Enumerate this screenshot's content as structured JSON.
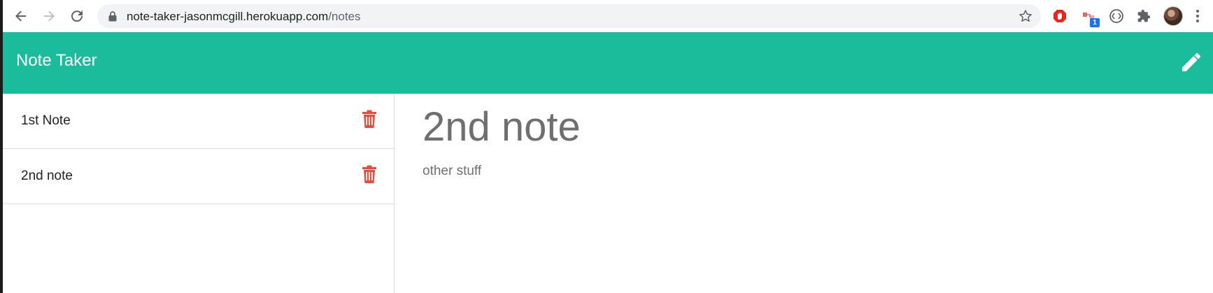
{
  "browser": {
    "url_host": "note-taker-jasonmcgill.herokuapp.com",
    "url_path": "/notes",
    "extension_badge_count": "1",
    "icons": [
      "back-icon",
      "forward-icon",
      "reload-icon",
      "lock-icon",
      "star-icon",
      "adblock-icon",
      "extension-badge-icon",
      "extension-circle-icon",
      "puzzle-icon",
      "avatar",
      "menu-icon"
    ]
  },
  "header": {
    "title": "Note Taker",
    "color": "#1abc9c",
    "new_note_icon": "pencil-icon"
  },
  "notes": [
    {
      "title": "1st Note",
      "delete_icon": "trash-icon"
    },
    {
      "title": "2nd note",
      "delete_icon": "trash-icon"
    }
  ],
  "active_note": {
    "title": "2nd note",
    "text": "other stuff"
  },
  "colors": {
    "accent": "#1abc9c",
    "delete": "#e74c3c",
    "note_text": "#6f6f6f"
  }
}
